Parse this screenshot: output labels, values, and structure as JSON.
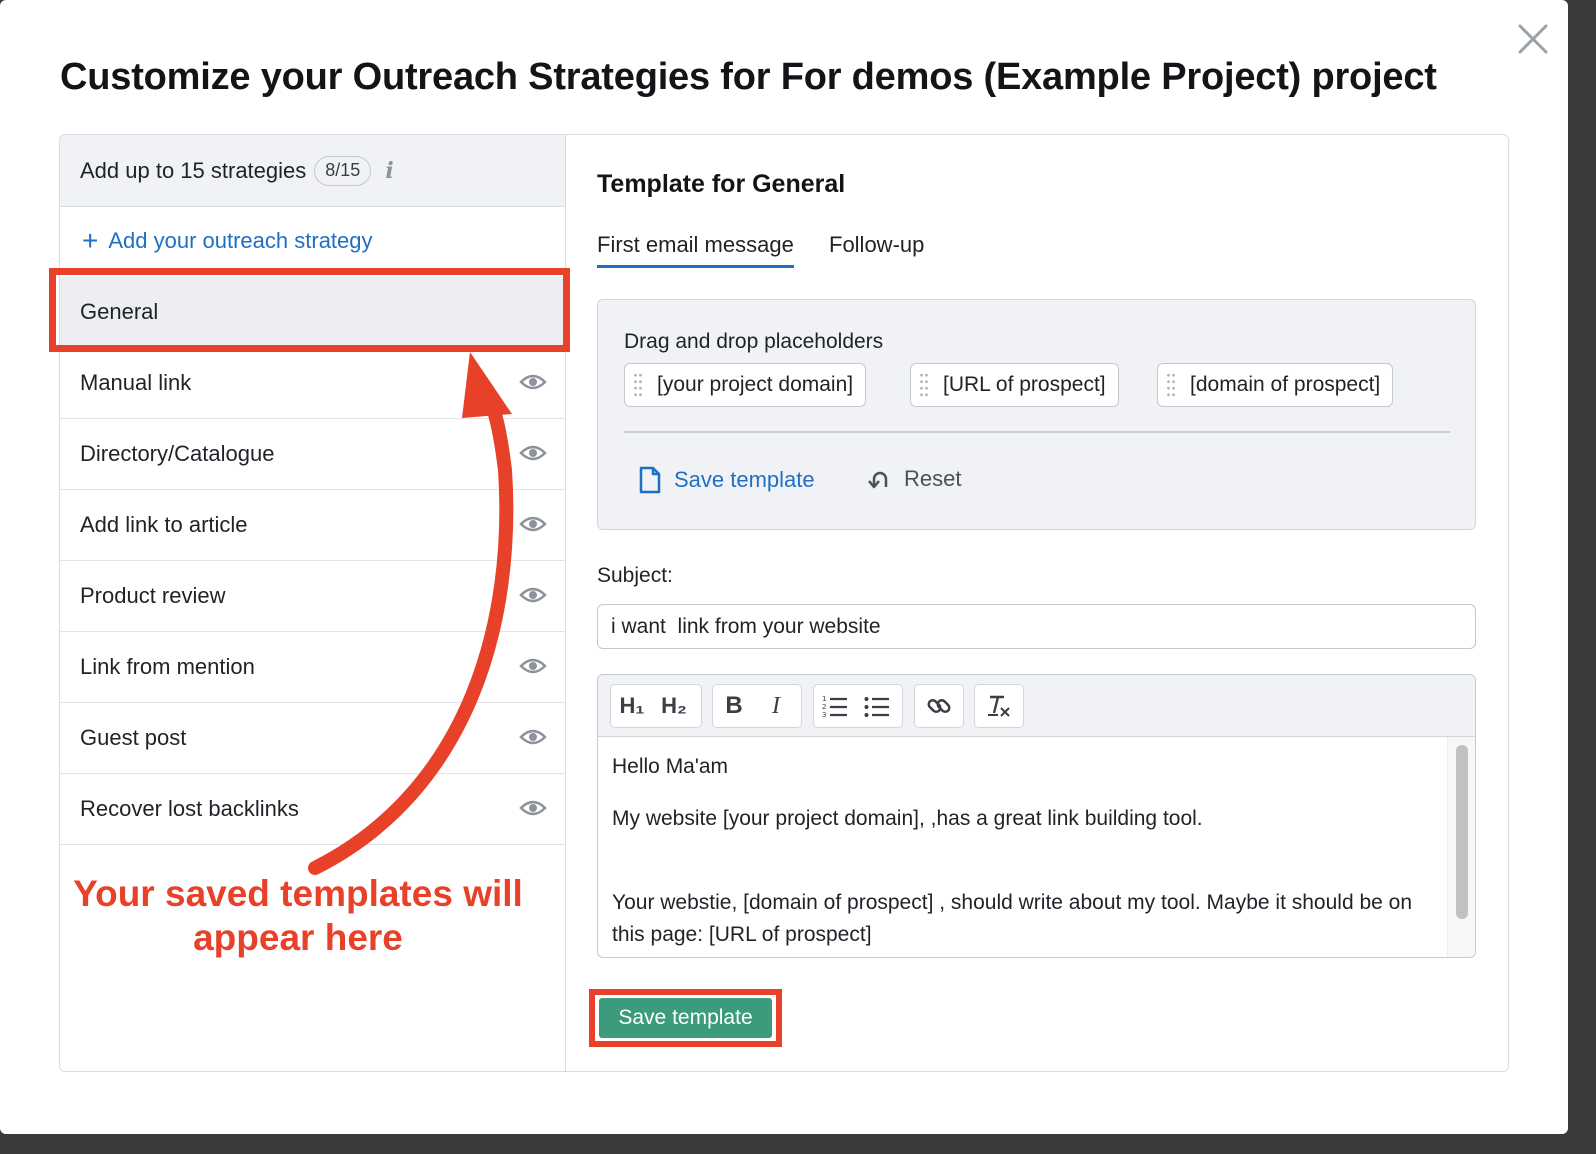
{
  "modal": {
    "title": "Customize your Outreach Strategies for For demos (Example Project) project"
  },
  "left": {
    "header_label": "Add up to 15 strategies",
    "count": "8/15",
    "info_icon": "i",
    "add_label": "Add your outreach strategy",
    "items": [
      {
        "label": "General",
        "selected": true
      },
      {
        "label": "Manual link"
      },
      {
        "label": "Directory/Catalogue"
      },
      {
        "label": "Add link to article"
      },
      {
        "label": "Product review"
      },
      {
        "label": "Link from mention"
      },
      {
        "label": "Guest post"
      },
      {
        "label": "Recover lost backlinks"
      }
    ]
  },
  "annotation": {
    "line1": "Your saved templates will",
    "line2": "appear here",
    "color": "#e8412a"
  },
  "right": {
    "title": "Template for General",
    "tabs": [
      {
        "label": "First email message",
        "active": true
      },
      {
        "label": "Follow-up"
      }
    ],
    "placeholders": {
      "label": "Drag and drop placeholders",
      "chips": [
        "[your project domain]",
        "[URL of prospect]",
        "[domain of prospect]"
      ],
      "save_label": "Save template",
      "reset_label": "Reset"
    },
    "subject": {
      "label": "Subject:",
      "value": "i want  link from your website"
    },
    "toolbar": {
      "h1": "H₁",
      "h2": "H₂",
      "bold": "B",
      "italic": "I"
    },
    "body": {
      "line1": "Hello Ma'am",
      "line2": "My website [your project domain], ,has a great link building tool.",
      "line3": "Your webstie, [domain of prospect] , should write about my tool. Maybe it should be on this page: [URL of prospect]"
    },
    "save_button": "Save template"
  },
  "colors": {
    "accent_blue": "#1f6fc4",
    "save_green": "#3b9b7c",
    "annotation_red": "#e8412a"
  }
}
